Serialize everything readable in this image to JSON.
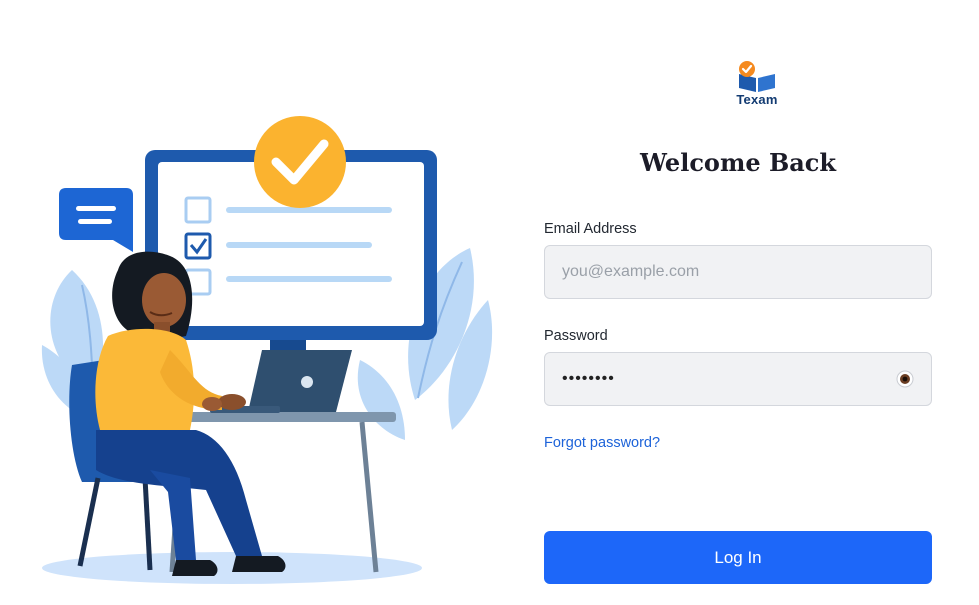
{
  "brand": {
    "name": "Texam"
  },
  "heading": "Welcome Back",
  "form": {
    "email": {
      "label": "Email Address",
      "placeholder": "you@example.com",
      "value": ""
    },
    "password": {
      "label": "Password",
      "value": "secret12"
    },
    "forgot_link": "Forgot password?",
    "submit_label": "Log In"
  },
  "colors": {
    "primary": "#1d67f9",
    "link": "#1d63d9",
    "illustration_blue": "#1e5aad",
    "accent_yellow": "#fbb32f"
  },
  "icons": [
    "logo-book-icon",
    "check-badge-icon",
    "chat-bubble-icon",
    "eye-icon"
  ]
}
